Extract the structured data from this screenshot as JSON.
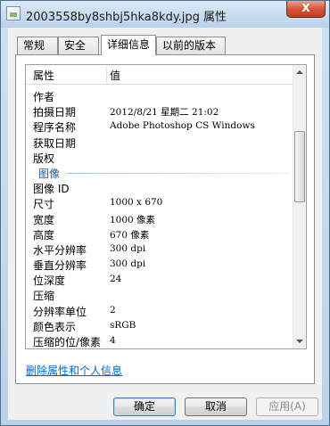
{
  "window": {
    "title": "2003558by8shbj5hka8kdy.jpg 属性",
    "close_label": "X"
  },
  "tabs": [
    {
      "label": "常规"
    },
    {
      "label": "安全"
    },
    {
      "label": "详细信息",
      "active": true
    },
    {
      "label": "以前的版本"
    }
  ],
  "list": {
    "header_property": "属性",
    "header_value": "值",
    "rows_top": [
      {
        "key": "作者",
        "value": ""
      },
      {
        "key": "拍摄日期",
        "value": "2012/8/21 星期二 21:02"
      },
      {
        "key": "程序名称",
        "value": "Adobe Photoshop CS Windows"
      },
      {
        "key": "获取日期",
        "value": ""
      },
      {
        "key": "版权",
        "value": ""
      }
    ],
    "group_label": "图像",
    "rows_image": [
      {
        "key": "图像 ID",
        "value": ""
      },
      {
        "key": "尺寸",
        "value": "1000 x 670"
      },
      {
        "key": "宽度",
        "value": "1000 像素"
      },
      {
        "key": "高度",
        "value": "670 像素"
      },
      {
        "key": "水平分辨率",
        "value": "300 dpi"
      },
      {
        "key": "垂直分辨率",
        "value": "300 dpi"
      },
      {
        "key": "位深度",
        "value": "24"
      },
      {
        "key": "压缩",
        "value": ""
      },
      {
        "key": "分辨率单位",
        "value": "2"
      },
      {
        "key": "颜色表示",
        "value": "sRGB"
      },
      {
        "key": "压缩的位/像素",
        "value": "4"
      }
    ]
  },
  "remove_link": "删除属性和个人信息",
  "buttons": {
    "ok": "确定",
    "cancel": "取消",
    "apply": "应用(A)"
  }
}
